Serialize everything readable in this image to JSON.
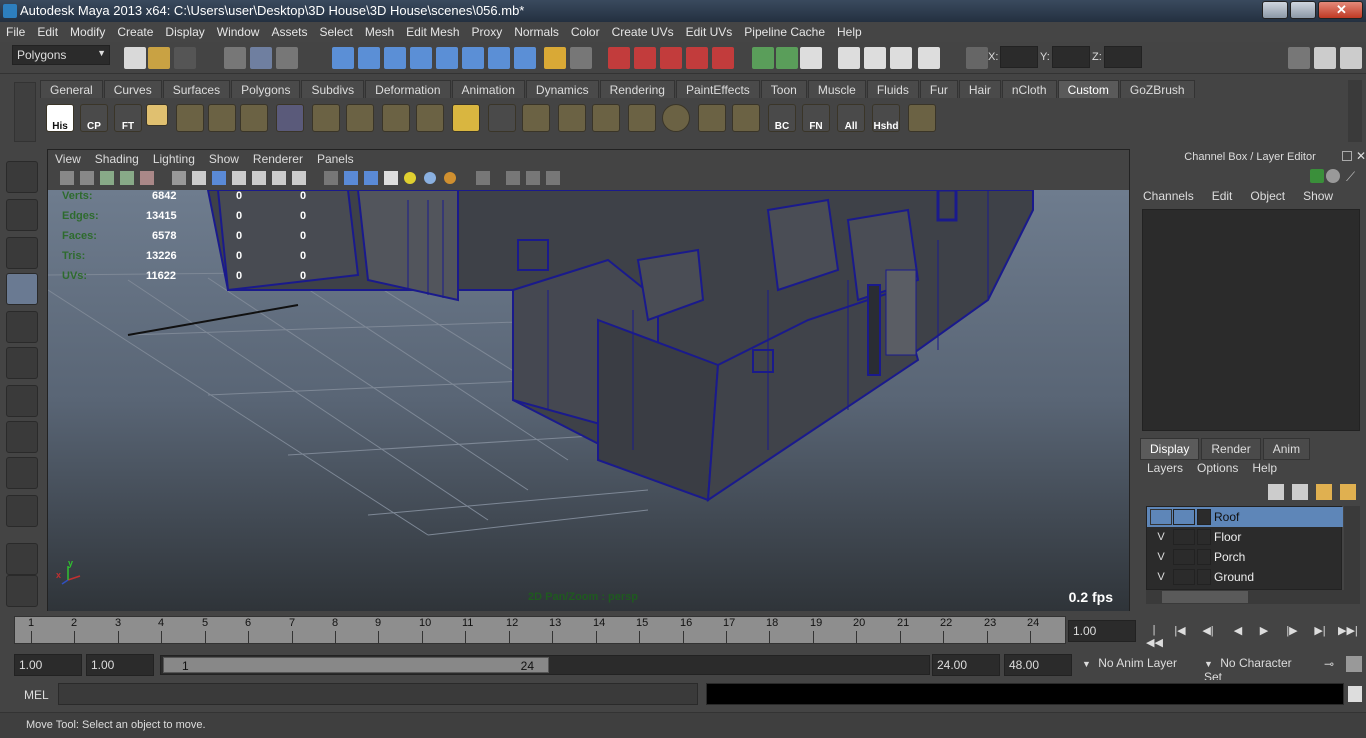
{
  "window": {
    "title": "Autodesk Maya 2013 x64: C:\\Users\\user\\Desktop\\3D House\\3D House\\scenes\\056.mb*"
  },
  "menubar": [
    "File",
    "Edit",
    "Modify",
    "Create",
    "Display",
    "Window",
    "Assets",
    "Select",
    "Mesh",
    "Edit Mesh",
    "Proxy",
    "Normals",
    "Color",
    "Create UVs",
    "Edit UVs",
    "Pipeline Cache",
    "Help"
  ],
  "statusline": {
    "menuset": "Polygons",
    "x_label": "X:",
    "y_label": "Y:",
    "z_label": "Z:"
  },
  "shelf": {
    "tabs": [
      "General",
      "Curves",
      "Surfaces",
      "Polygons",
      "Subdivs",
      "Deformation",
      "Animation",
      "Dynamics",
      "Rendering",
      "PaintEffects",
      "Toon",
      "Muscle",
      "Fluids",
      "Fur",
      "Hair",
      "nCloth",
      "Custom",
      "GoZBrush"
    ],
    "active_tab": "Custom",
    "labels": {
      "his": "His",
      "cp": "CP",
      "ft": "FT",
      "bc": "BC",
      "fn": "FN",
      "all": "All",
      "hshd": "Hshd"
    }
  },
  "viewport": {
    "menu": [
      "View",
      "Shading",
      "Lighting",
      "Show",
      "Renderer",
      "Panels"
    ],
    "hud": {
      "rows": [
        {
          "label": "Verts:",
          "v1": "6842",
          "v2": "0",
          "v3": "0"
        },
        {
          "label": "Edges:",
          "v1": "13415",
          "v2": "0",
          "v3": "0"
        },
        {
          "label": "Faces:",
          "v1": "6578",
          "v2": "0",
          "v3": "0"
        },
        {
          "label": "Tris:",
          "v1": "13226",
          "v2": "0",
          "v3": "0"
        },
        {
          "label": "UVs:",
          "v1": "11622",
          "v2": "0",
          "v3": "0"
        }
      ]
    },
    "fps": "0.2 fps",
    "camera_label": "2D Pan/Zoom : persp",
    "axis_x": "x",
    "axis_y": "y"
  },
  "channelbox": {
    "title": "Channel Box / Layer Editor",
    "menu": [
      "Channels",
      "Edit",
      "Object",
      "Show"
    ]
  },
  "layer_editor": {
    "tabs": [
      "Display",
      "Render",
      "Anim"
    ],
    "active_tab": "Display",
    "menu": [
      "Layers",
      "Options",
      "Help"
    ],
    "layers": [
      {
        "v": "",
        "name": "Roof",
        "selected": true
      },
      {
        "v": "V",
        "name": "Floor",
        "selected": false
      },
      {
        "v": "V",
        "name": "Porch",
        "selected": false
      },
      {
        "v": "V",
        "name": "Ground",
        "selected": false
      }
    ]
  },
  "timeslider": {
    "ticks": [
      "1",
      "2",
      "3",
      "4",
      "5",
      "6",
      "7",
      "8",
      "9",
      "10",
      "11",
      "12",
      "13",
      "14",
      "15",
      "16",
      "17",
      "18",
      "19",
      "20",
      "21",
      "22",
      "23",
      "24"
    ],
    "current_frame": "1.00"
  },
  "rangeslider": {
    "start_time": "1.00",
    "playback_start": "1.00",
    "range_start": "1",
    "range_end": "24",
    "playback_end": "24.00",
    "end_time": "48.00",
    "anim_layer": "No Anim Layer",
    "character_set": "No Character Set"
  },
  "commandline": {
    "label": "MEL"
  },
  "helpline": {
    "text": "Move Tool: Select an object to move."
  },
  "colors": {
    "accent": "#5e86b8",
    "wire": "#1a1a8c",
    "hud_green": "#2e6b2e"
  }
}
